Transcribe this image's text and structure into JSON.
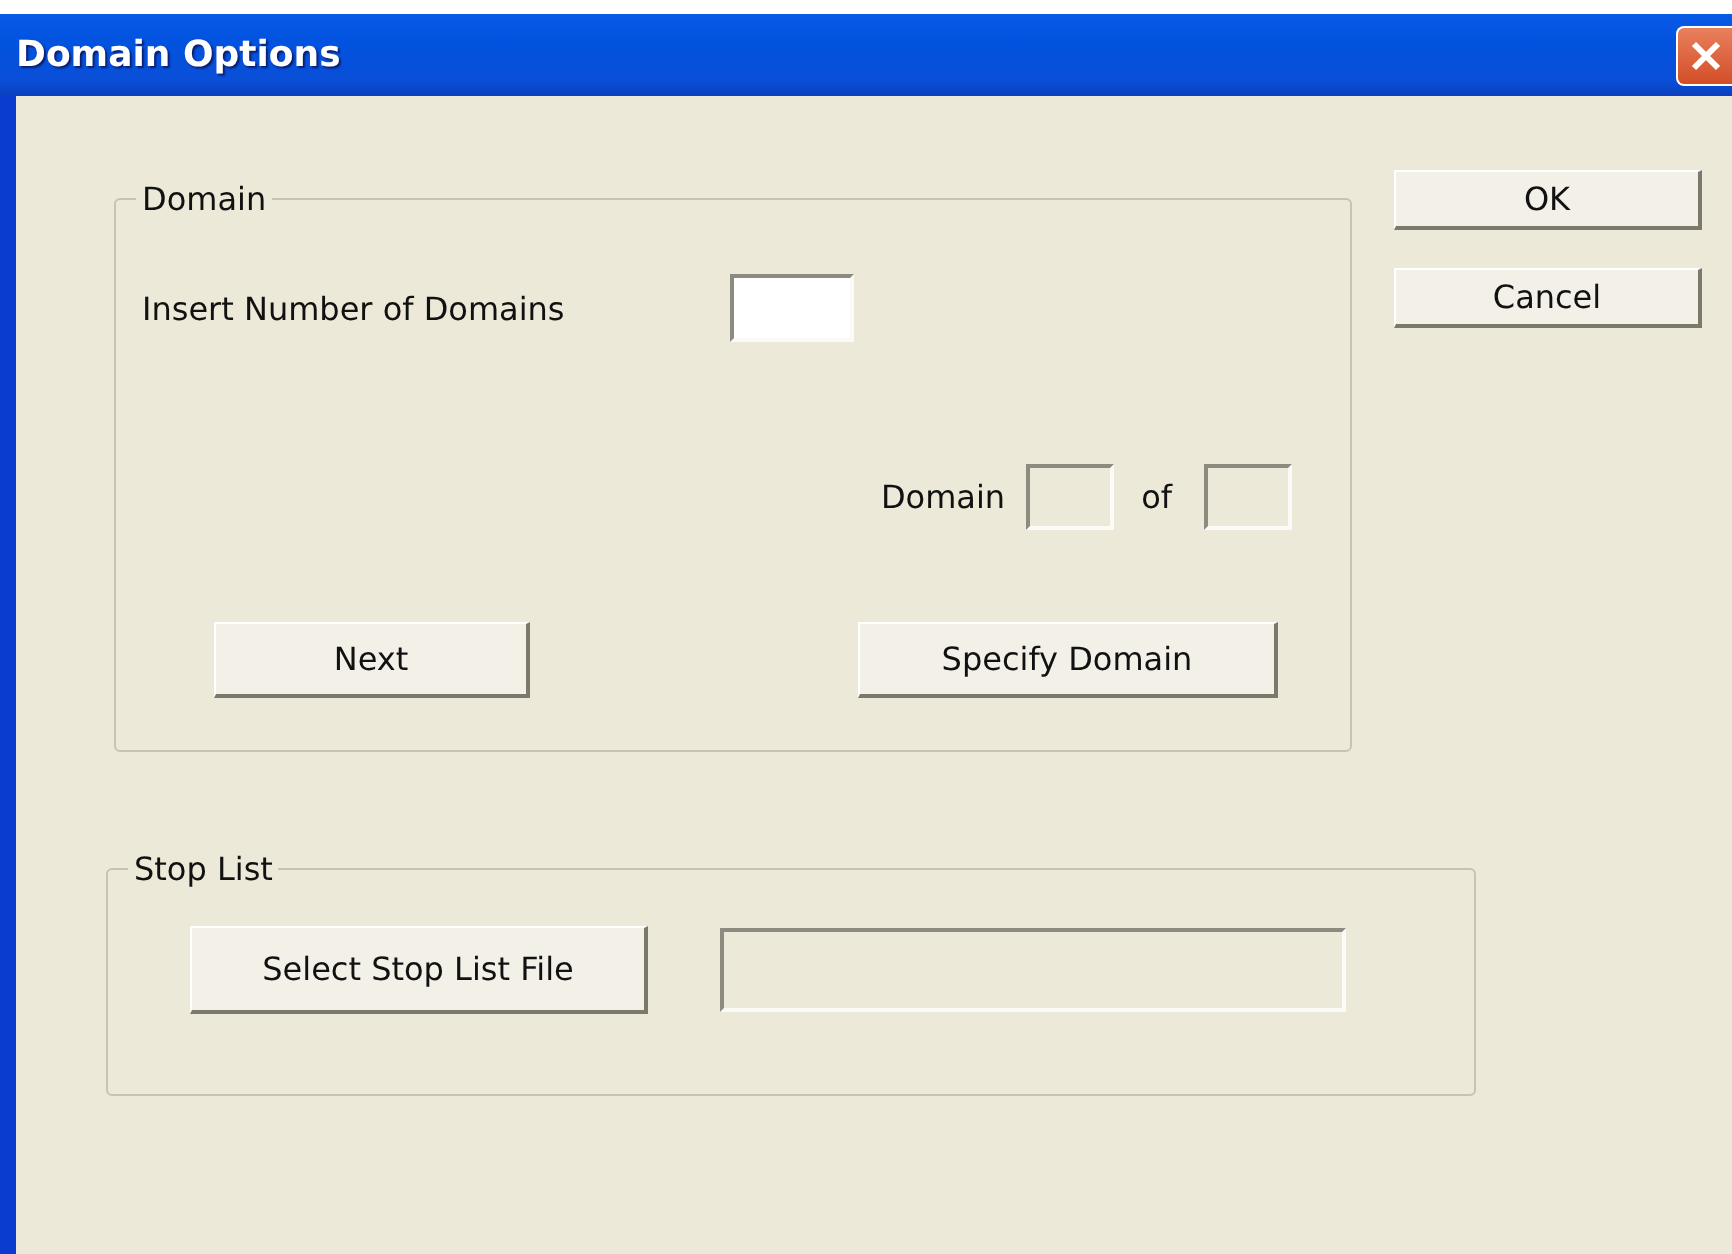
{
  "window": {
    "title": "Domain Options"
  },
  "domain_group": {
    "title": "Domain",
    "number_label": "Insert Number of Domains",
    "number_field": {
      "disabled": false
    },
    "domain_label": "Domain",
    "current_field": {
      "disabled": true
    },
    "of_label": "of",
    "total_field": {
      "disabled": true
    },
    "buttons": [
      "Next",
      "Specify Domain"
    ]
  },
  "stop_list_group": {
    "title": "Stop List",
    "button": "Select Stop List File",
    "file_field": {
      "disabled": true
    }
  },
  "dialog_buttons": [
    "OK",
    "Cancel"
  ]
}
